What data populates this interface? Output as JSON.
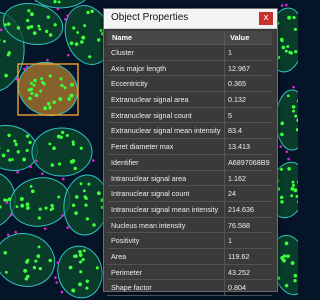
{
  "window": {
    "title": "Object Properties",
    "close_glyph": "x"
  },
  "table": {
    "columns": [
      "Name",
      "Value"
    ],
    "rows": [
      {
        "name": "Cluster",
        "value": "1"
      },
      {
        "name": "Axis major length",
        "value": "12.967"
      },
      {
        "name": "Eccentricity",
        "value": "0.365"
      },
      {
        "name": "Extranuclear signal area",
        "value": "0.132"
      },
      {
        "name": "Extranuclear signal count",
        "value": "5"
      },
      {
        "name": "Extranuclear signal mean intensity",
        "value": "83.4"
      },
      {
        "name": "Feret diameter max",
        "value": "13.413"
      },
      {
        "name": "Identifier",
        "value": "A6897068B9"
      },
      {
        "name": "Intranuclear signal area",
        "value": "1.162"
      },
      {
        "name": "Intranuclear signal count",
        "value": "24"
      },
      {
        "name": "Intranuclear signal mean intensity",
        "value": "214.636"
      },
      {
        "name": "Nucleus mean intensity",
        "value": "76.588"
      },
      {
        "name": "Positivity",
        "value": "1"
      },
      {
        "name": "Area",
        "value": "119.62"
      },
      {
        "name": "Perimeter",
        "value": "43.252"
      },
      {
        "name": "Shape factor",
        "value": "0.804"
      }
    ]
  },
  "colors": {
    "background": "#061427",
    "nucleus": "#0b4a2d",
    "cell_outline": "#2fc4c4",
    "signal": "#3aff3a",
    "extranuclear_signal": "#d92bd9",
    "selection": "#f0a030",
    "dialog_bg": "#3a3a3a",
    "close_button": "#c8312c"
  }
}
